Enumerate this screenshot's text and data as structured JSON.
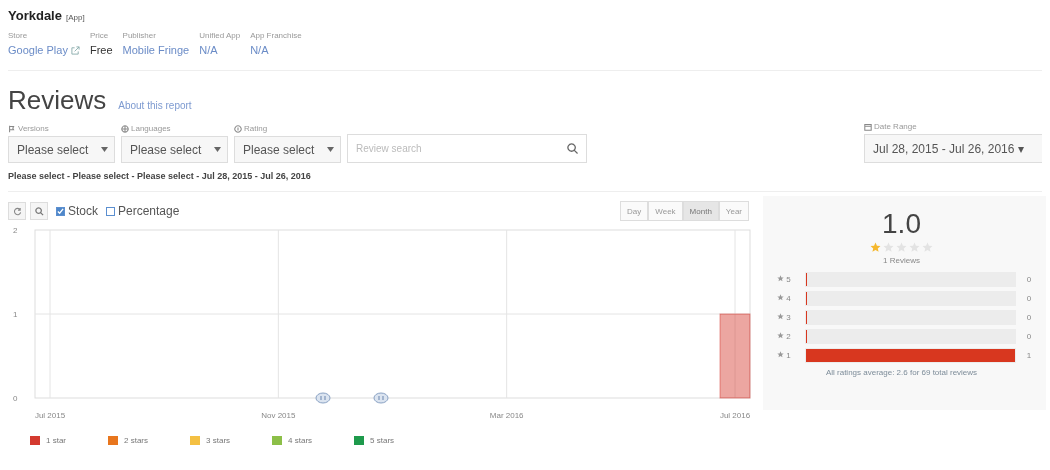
{
  "app": {
    "title": "Yorkdale",
    "tag": "[App]",
    "meta": [
      {
        "label": "Store",
        "value": "Google Play",
        "kind": "link-external"
      },
      {
        "label": "Price",
        "value": "Free",
        "kind": "plain"
      },
      {
        "label": "Publisher",
        "value": "Mobile Fringe",
        "kind": "link"
      },
      {
        "label": "Unified App",
        "value": "N/A",
        "kind": "link"
      },
      {
        "label": "App Franchise",
        "value": "N/A",
        "kind": "link"
      }
    ]
  },
  "report": {
    "title": "Reviews",
    "about_link": "About this report"
  },
  "filters": [
    {
      "label": "Versions",
      "value": "Please select",
      "kind": "versions"
    },
    {
      "label": "Languages",
      "value": "Please select",
      "kind": "languages"
    },
    {
      "label": "Rating",
      "value": "Please select",
      "kind": "rating"
    }
  ],
  "search": {
    "placeholder": "Review search"
  },
  "date_range": {
    "label": "Date Range",
    "value": "Jul 28, 2015 - Jul 26, 2016 ▾"
  },
  "summary": "Please select - Please select - Please select - Jul 28, 2015 - Jul 26, 2016",
  "toolbar": {
    "options": [
      {
        "label": "Stock",
        "checked": true
      },
      {
        "label": "Percentage",
        "checked": false
      }
    ],
    "periods": [
      {
        "label": "Day",
        "selected": false
      },
      {
        "label": "Week",
        "selected": false
      },
      {
        "label": "Month",
        "selected": true
      },
      {
        "label": "Year",
        "selected": false
      }
    ]
  },
  "chart": {
    "chart_data": {
      "type": "bar",
      "stacked": true,
      "categories": [
        "Jul 2015",
        "Nov 2015",
        "Mar 2016",
        "Jul 2016"
      ],
      "series": [
        {
          "name": "1 star",
          "color": "#d43a2f",
          "values": [
            0,
            0,
            0,
            1
          ]
        },
        {
          "name": "2 stars",
          "color": "#e8761e",
          "values": [
            0,
            0,
            0,
            0
          ]
        },
        {
          "name": "3 stars",
          "color": "#f4c043",
          "values": [
            0,
            0,
            0,
            0
          ]
        },
        {
          "name": "4 stars",
          "color": "#8cbf48",
          "values": [
            0,
            0,
            0,
            0
          ]
        },
        {
          "name": "5 stars",
          "color": "#1e9a4c",
          "values": [
            0,
            0,
            0,
            0
          ]
        }
      ],
      "grid": true,
      "ylim": [
        0,
        2
      ],
      "yticks": [
        0,
        1,
        2
      ]
    }
  },
  "rating": {
    "score": "1.0",
    "stars": 1,
    "count_text": "1 Reviews",
    "rows": [
      {
        "label": "5",
        "count": "0",
        "level": 0
      },
      {
        "label": "4",
        "count": "0",
        "level": 0
      },
      {
        "label": "3",
        "count": "0",
        "level": 0
      },
      {
        "label": "2",
        "count": "0",
        "level": 0
      },
      {
        "label": "1",
        "count": "1",
        "level": 1
      }
    ],
    "footer": "All ratings average: 2.6 for 69 total reviews"
  }
}
